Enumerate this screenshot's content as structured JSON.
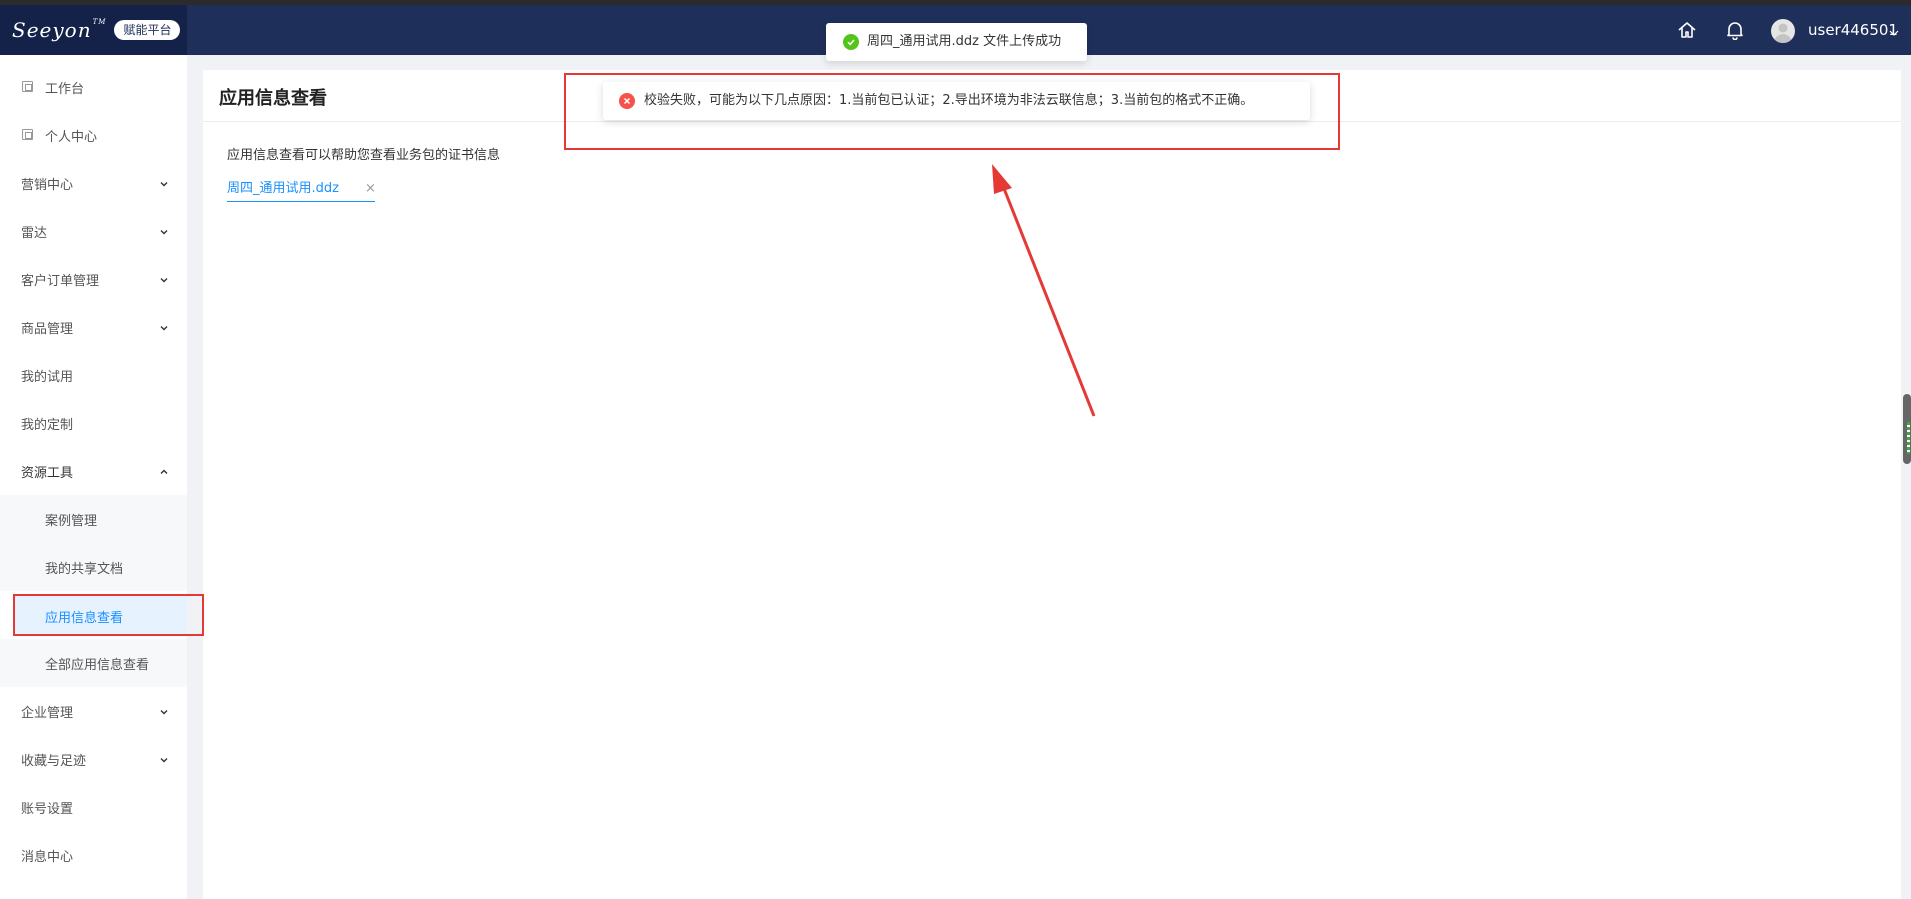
{
  "header": {
    "logo_text": "Seeyon",
    "logo_tm": "TM",
    "badge": "赋能平台",
    "username": "user446501"
  },
  "sidebar": {
    "items": [
      {
        "label": "工作台",
        "icon": "page-icon"
      },
      {
        "label": "个人中心",
        "icon": "page-icon"
      },
      {
        "label": "营销中心",
        "expandable": "chevron-down-icon"
      },
      {
        "label": "雷达",
        "expandable": "chevron-down-icon"
      },
      {
        "label": "客户订单管理",
        "expandable": "chevron-down-icon"
      },
      {
        "label": "商品管理",
        "expandable": "chevron-down-icon"
      },
      {
        "label": "我的试用"
      },
      {
        "label": "我的定制"
      },
      {
        "label": "资源工具",
        "expandable": "chevron-up-icon"
      },
      {
        "label": "案例管理"
      },
      {
        "label": "我的共享文档"
      },
      {
        "label": "应用信息查看"
      },
      {
        "label": "全部应用信息查看"
      },
      {
        "label": "企业管理",
        "expandable": "chevron-down-icon"
      },
      {
        "label": "收藏与足迹",
        "expandable": "chevron-down-icon"
      },
      {
        "label": "账号设置"
      },
      {
        "label": "消息中心"
      }
    ]
  },
  "main": {
    "title": "应用信息查看",
    "description": "应用信息查看可以帮助您查看业务包的证书信息",
    "file": {
      "name": "周四_通用试用.ddz",
      "remove": "×"
    }
  },
  "toasts": {
    "success": "周四_通用试用.ddz 文件上传成功",
    "error": "校验失败，可能为以下几点原因：1.当前包已认证；2.导出环境为非法云联信息；3.当前包的格式不正确。"
  },
  "colors": {
    "header_bg": "#1e2f5a",
    "accent": "#1890ff",
    "success": "#52c41a",
    "error": "#f5524c",
    "annotation": "#e53935"
  }
}
